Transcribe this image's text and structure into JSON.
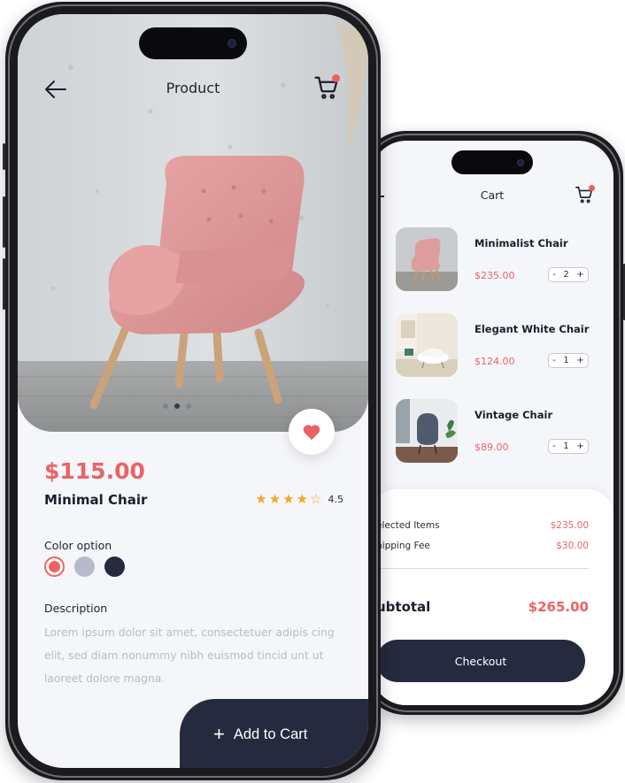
{
  "product_screen": {
    "header": {
      "title": "Product",
      "back_icon": "arrow-left-icon",
      "cart_icon": "shopping-cart-icon"
    },
    "carousel": {
      "count": 3,
      "active": 2
    },
    "favorite_icon": "heart-icon",
    "product": {
      "price": "$115.00",
      "name": "Minimal Chair",
      "rating_value": "4.5",
      "rating_stars": 4.5
    },
    "color_option": {
      "label": "Color option",
      "options": [
        "#ea6363",
        "#b8b9cc",
        "#262a3f"
      ],
      "selected": 0
    },
    "description": {
      "label": "Description",
      "text": "Lorem ipsum dolor sit amet, consectetuer adipis cing elit, sed diam nonummy nibh euismod tincid unt ut laoreet dolore magna."
    },
    "add_to_cart": {
      "label": "Add to Cart",
      "icon": "plus-icon"
    }
  },
  "cart_screen": {
    "header": {
      "title": "Cart",
      "cart_icon": "shopping-cart-icon"
    },
    "items": [
      {
        "name": "Minimalist Chair",
        "price": "$235.00",
        "qty": "2",
        "minus": "-",
        "plus": "+"
      },
      {
        "name": "Elegant White Chair",
        "price": "$124.00",
        "qty": "1",
        "minus": "-",
        "plus": "+"
      },
      {
        "name": "Vintage Chair",
        "price": "$89.00",
        "qty": "1",
        "minus": "-",
        "plus": "+"
      }
    ],
    "summary": {
      "selected_items_label": "elected Items",
      "selected_items_value": "$235.00",
      "shipping_fee_label": "hipping Fee",
      "shipping_fee_value": "$30.00",
      "subtotal_label": "ubtotal",
      "subtotal_value": "$265.00"
    },
    "checkout_label": "Checkout"
  },
  "colors": {
    "accent": "#ea6363",
    "dark": "#262a3f",
    "star": "#f5a623",
    "background": "#f5f6fa"
  }
}
